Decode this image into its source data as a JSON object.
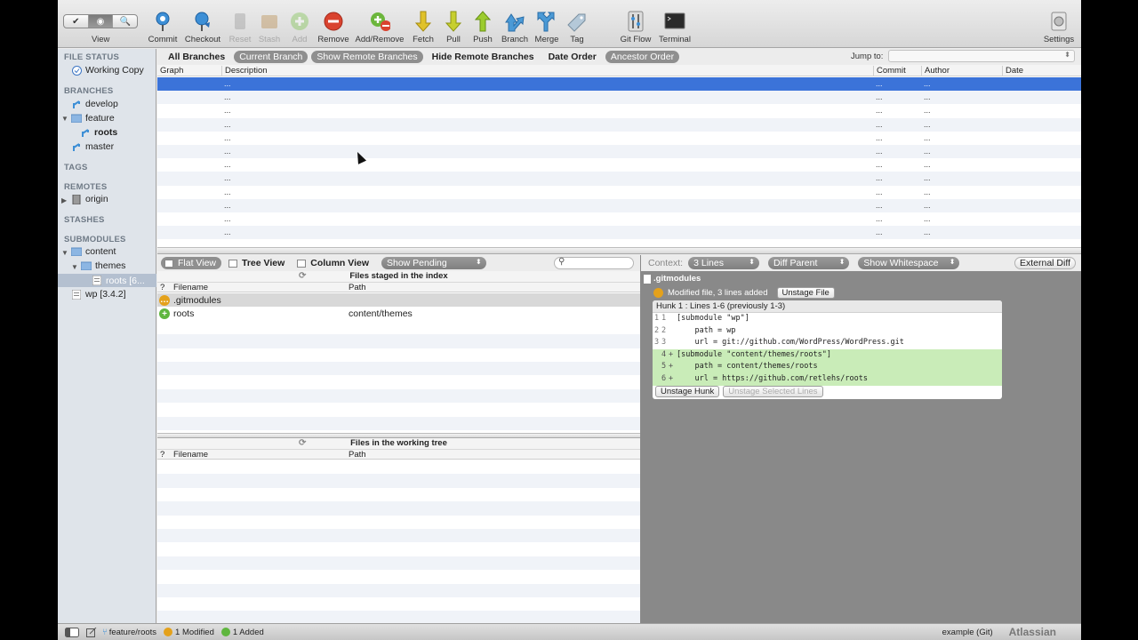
{
  "toolbar": {
    "view_segments": [
      "✔",
      "◉",
      "🔍"
    ],
    "view_label": "View",
    "buttons": [
      {
        "label": "Commit",
        "icon": "commit-icon",
        "enabled": true
      },
      {
        "label": "Checkout",
        "icon": "checkout-icon",
        "enabled": true
      },
      {
        "label": "Reset",
        "icon": "reset-icon",
        "enabled": false
      },
      {
        "label": "Stash",
        "icon": "stash-icon",
        "enabled": false
      },
      {
        "label": "Add",
        "icon": "add-icon",
        "enabled": false
      },
      {
        "label": "Remove",
        "icon": "remove-icon",
        "enabled": true
      },
      {
        "label": "Add/Remove",
        "icon": "add-remove-icon",
        "enabled": true
      },
      {
        "label": "Fetch",
        "icon": "fetch-icon",
        "enabled": true
      },
      {
        "label": "Pull",
        "icon": "pull-icon",
        "enabled": true
      },
      {
        "label": "Push",
        "icon": "push-icon",
        "enabled": true
      },
      {
        "label": "Branch",
        "icon": "branch-icon",
        "enabled": true
      },
      {
        "label": "Merge",
        "icon": "merge-icon",
        "enabled": true
      },
      {
        "label": "Tag",
        "icon": "tag-icon",
        "enabled": true
      },
      {
        "label": "Git Flow",
        "icon": "git-flow-icon",
        "enabled": true
      },
      {
        "label": "Terminal",
        "icon": "terminal-icon",
        "enabled": true
      },
      {
        "label": "Settings",
        "icon": "settings-icon",
        "enabled": true
      }
    ]
  },
  "sidebar": {
    "file_status": {
      "header": "FILE STATUS",
      "items": [
        "Working Copy"
      ]
    },
    "branches": {
      "header": "BRANCHES",
      "items": [
        "develop",
        "feature",
        "roots",
        "master"
      ]
    },
    "tags": {
      "header": "TAGS"
    },
    "remotes": {
      "header": "REMOTES",
      "items": [
        "origin"
      ]
    },
    "stashes": {
      "header": "STASHES"
    },
    "submodules": {
      "header": "SUBMODULES",
      "items": [
        "content",
        "themes",
        "roots [6...",
        "wp [3.4.2]"
      ]
    }
  },
  "filter": {
    "all_branches": "All Branches",
    "current_branch": "Current Branch",
    "show_remote": "Show Remote Branches",
    "hide_remote": "Hide Remote Branches",
    "date_order": "Date Order",
    "ancestor_order": "Ancestor Order",
    "jump_to": "Jump to:"
  },
  "history": {
    "columns": {
      "graph": "Graph",
      "description": "Description",
      "commit": "Commit",
      "author": "Author",
      "date": "Date"
    },
    "placeholder": "...",
    "row_count": 12
  },
  "files": {
    "flat_view": "Flat View",
    "tree_view": "Tree View",
    "column_view": "Column View",
    "show_pending": "Show Pending",
    "staged_title": "Files staged in the index",
    "working_title": "Files in the working tree",
    "col_status": "?",
    "col_filename": "Filename",
    "col_path": "Path",
    "staged": [
      {
        "name": ".gitmodules",
        "path": "",
        "status": "modified"
      },
      {
        "name": "roots",
        "path": "content/themes",
        "status": "added"
      }
    ]
  },
  "diff": {
    "context_label": "Context:",
    "context_value": "3 Lines",
    "diff_parent": "Diff Parent",
    "show_whitespace": "Show Whitespace",
    "external_diff": "External Diff",
    "file": ".gitmodules",
    "modified_text": "Modified file, 3 lines added",
    "unstage_file": "Unstage File",
    "hunk_header": "Hunk 1 : Lines 1-6 (previously 1-3)",
    "lines": [
      {
        "old": "1",
        "new": "1",
        "mark": "",
        "text": "[submodule \"wp\"]",
        "added": false
      },
      {
        "old": "2",
        "new": "2",
        "mark": "",
        "text": "    path = wp",
        "added": false
      },
      {
        "old": "3",
        "new": "3",
        "mark": "",
        "text": "    url = git://github.com/WordPress/WordPress.git",
        "added": false
      },
      {
        "old": "",
        "new": "4",
        "mark": "+",
        "text": "[submodule \"content/themes/roots\"]",
        "added": true
      },
      {
        "old": "",
        "new": "5",
        "mark": "+",
        "text": "    path = content/themes/roots",
        "added": true
      },
      {
        "old": "",
        "new": "6",
        "mark": "+",
        "text": "    url = https://github.com/retlehs/roots",
        "added": true
      }
    ],
    "unstage_hunk": "Unstage Hunk",
    "unstage_selected": "Unstage Selected Lines"
  },
  "status": {
    "branch": "feature/roots",
    "modified": "1 Modified",
    "added": "1 Added",
    "repo": "example (Git)",
    "brand": "Atlassian"
  },
  "colors": {
    "selection": "#3b73d9",
    "added_bg": "#c9ecb8",
    "modified": "#e4a11b",
    "added": "#5fb63f"
  }
}
